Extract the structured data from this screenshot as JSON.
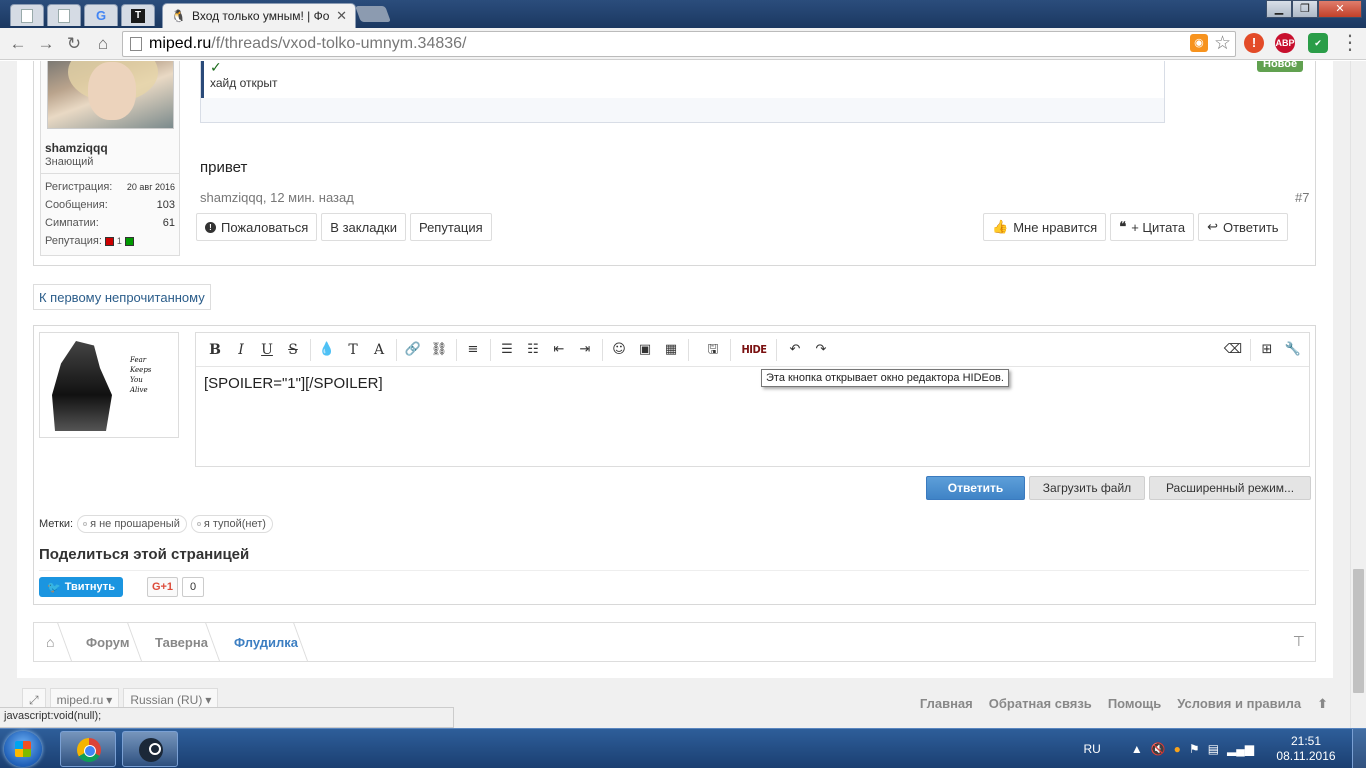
{
  "browser": {
    "active_tab_title": "Вход только умным! | Фо",
    "url_host": "miped.ru",
    "url_path": "/f/threads/vxod-tolko-umnym.34836/",
    "ext_abp": "ABP"
  },
  "post": {
    "user": {
      "name": "shamziqqq",
      "title": "Знающий",
      "stats": [
        {
          "label": "Регистрация:",
          "value": "20 авг 2016"
        },
        {
          "label": "Сообщения:",
          "value": "103"
        },
        {
          "label": "Симпатии:",
          "value": "61"
        }
      ],
      "rep_label": "Репутация:",
      "rep_value": "1"
    },
    "quote_check": "✓",
    "quote_text": "хайд открыт",
    "new_badge": "Новое",
    "message": "привет",
    "meta": "shamziqqq, 12 мин. назад",
    "post_number": "#7",
    "actions_left": [
      "Пожаловаться",
      "В закладки",
      "Репутация"
    ],
    "actions_right": [
      "Мне нравится",
      "+ Цитата",
      "Ответить"
    ]
  },
  "unread_link": "К первому непрочитанному",
  "reply": {
    "avatar_caption": [
      "Fear",
      "Keeps",
      "You",
      "Alive"
    ],
    "editor_content": "[SPOILER=\"1\"][/SPOILER]",
    "hide_button": "HIDE",
    "tooltip": "Эта кнопка открывает окно редактора HIDEов.",
    "submit": "Ответить",
    "upload": "Загрузить файл",
    "advanced": "Расширенный режим..."
  },
  "tags": {
    "label": "Метки:",
    "items": [
      "я не прошареный",
      "я тупой(нет)"
    ]
  },
  "share": {
    "title": "Поделиться этой страницей",
    "tweet": "Твитнуть",
    "gplus": "G+1",
    "gplus_count": "0"
  },
  "breadcrumb": [
    "Форум",
    "Таверна",
    "Флудилка"
  ],
  "footer": {
    "style_select": "miped.ru",
    "lang_select": "Russian (RU)",
    "links": [
      "Главная",
      "Обратная связь",
      "Помощь",
      "Условия и правила"
    ]
  },
  "status_bar": "javascript:void(null);",
  "taskbar": {
    "lang": "RU",
    "time": "21:51",
    "date": "08.11.2016"
  }
}
